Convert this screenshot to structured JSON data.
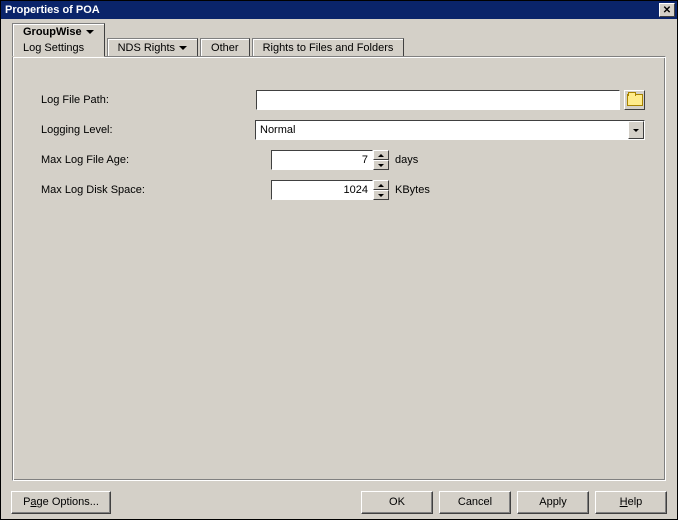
{
  "window": {
    "title": "Properties of POA"
  },
  "tabs": {
    "groupwise": {
      "label": "GroupWise",
      "sub": "Log Settings"
    },
    "nds": {
      "label": "NDS Rights"
    },
    "other": {
      "label": "Other"
    },
    "rights": {
      "label": "Rights to Files and Folders"
    }
  },
  "form": {
    "log_file_path": {
      "label": "Log File Path:",
      "value": ""
    },
    "logging_level": {
      "label": "Logging Level:",
      "value": "Normal"
    },
    "max_log_file_age": {
      "label": "Max Log File Age:",
      "value": "7",
      "unit": "days"
    },
    "max_log_disk_space": {
      "label": "Max Log Disk Space:",
      "value": "1024",
      "unit": "KBytes"
    }
  },
  "buttons": {
    "page_options_pre": "P",
    "page_options_ul": "a",
    "page_options_post": "ge Options...",
    "ok": "OK",
    "cancel": "Cancel",
    "apply": "Apply",
    "help_ul": "H",
    "help_post": "elp"
  }
}
